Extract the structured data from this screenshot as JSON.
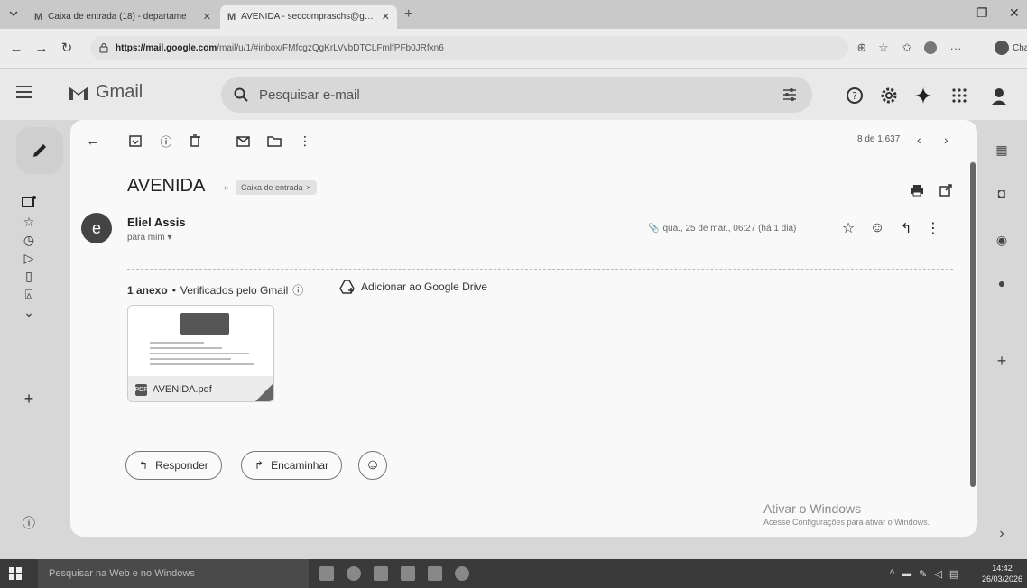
{
  "browser": {
    "tabs": [
      {
        "title": "Caixa de entrada (18) - departame",
        "active": false
      },
      {
        "title": "AVENIDA - seccompraschs@gmail.",
        "active": true
      }
    ],
    "url_host": "https://mail.google.com",
    "url_path": "/mail/u/1/#inbox/FMfcgzQgKrLVvbDTCLFmlfPFb0JRfxn6",
    "chat_label": "Chat"
  },
  "gmail": {
    "product_name": "Gmail",
    "search_placeholder": "Pesquisar e-mail"
  },
  "toolbar": {
    "pager": "8 de 1.637"
  },
  "email": {
    "subject": "AVENIDA",
    "label": "Caixa de entrada",
    "sender_name": "Eliel Assis",
    "avatar_letter": "e",
    "recipient": "para mim",
    "date": "qua., 25 de mar., 06:27 (há 1 dia)",
    "attachments_count": "1 anexo",
    "verified_text": "Verificados pelo Gmail",
    "add_to_drive": "Adicionar ao Google Drive",
    "attachment_filename": "AVENIDA.pdf",
    "reply_label": "Responder",
    "forward_label": "Encaminhar"
  },
  "windows": {
    "activate_title": "Ativar o Windows",
    "activate_subtitle": "Acesse Configurações para ativar o Windows.",
    "taskbar_search": "Pesquisar na Web e no Windows",
    "time": "14:42",
    "date": "26/03/2026"
  },
  "colors": {
    "accent": "#555555",
    "background": "#f9f9f9"
  }
}
